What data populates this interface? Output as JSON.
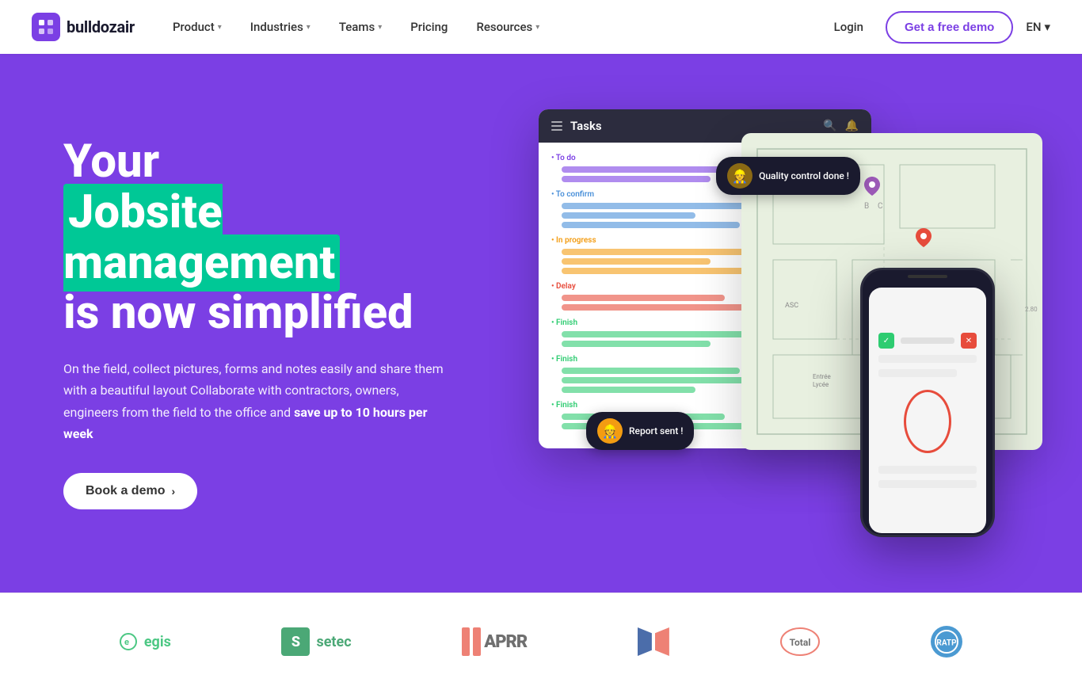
{
  "nav": {
    "logo_text": "bulldozair",
    "items": [
      {
        "label": "Product",
        "has_dropdown": true
      },
      {
        "label": "Industries",
        "has_dropdown": true
      },
      {
        "label": "Teams",
        "has_dropdown": true
      },
      {
        "label": "Pricing",
        "has_dropdown": false
      },
      {
        "label": "Resources",
        "has_dropdown": true
      }
    ],
    "login_label": "Login",
    "demo_label": "Get a free demo",
    "lang": "EN"
  },
  "hero": {
    "heading_line1": "Your",
    "heading_line2": "Jobsite management",
    "heading_line3": "is now simplified",
    "description_part1": "On the field, collect pictures, forms and notes easily and share them with a beautiful layout Collaborate with contractors, owners, engineers from the field to the office and ",
    "description_bold": "save up to 10 hours per week",
    "cta_label": "Book a demo"
  },
  "tasks_panel": {
    "title": "Tasks",
    "categories": [
      {
        "label": "• To do",
        "color": "#7b3fe4",
        "bars": [
          0.7,
          0.5
        ]
      },
      {
        "label": "• To confirm",
        "color": "#4a90d9",
        "bars": [
          0.8,
          0.45,
          0.6
        ]
      },
      {
        "label": "• In progress",
        "color": "#f39c12",
        "bars": [
          0.75,
          0.5,
          0.65
        ]
      },
      {
        "label": "• Delay",
        "color": "#e74c3c",
        "bars": [
          0.55,
          0.7
        ]
      },
      {
        "label": "• Finish",
        "color": "#2ecc71",
        "bars": [
          0.8,
          0.5
        ]
      },
      {
        "label": "• Finish",
        "color": "#2ecc71",
        "bars": [
          0.6,
          0.75,
          0.45
        ]
      },
      {
        "label": "• Finish",
        "color": "#2ecc71",
        "bars": [
          0.55,
          0.7
        ]
      }
    ]
  },
  "notifications": {
    "quality": "Quality control done !",
    "report": "Report sent !"
  },
  "logos": [
    {
      "name": "egis",
      "color": "#00b050",
      "symbol": "e"
    },
    {
      "name": "setec",
      "color": "#00843d",
      "symbol": "S"
    },
    {
      "name": "APRR",
      "color": "#e74c3c",
      "symbol": "A"
    },
    {
      "name": "Carrefour",
      "color": "#003087",
      "symbol": "C"
    },
    {
      "name": "Total",
      "color": "#e74c3c",
      "symbol": "T"
    },
    {
      "name": "RATP",
      "color": "#0070c0",
      "symbol": "R"
    }
  ]
}
